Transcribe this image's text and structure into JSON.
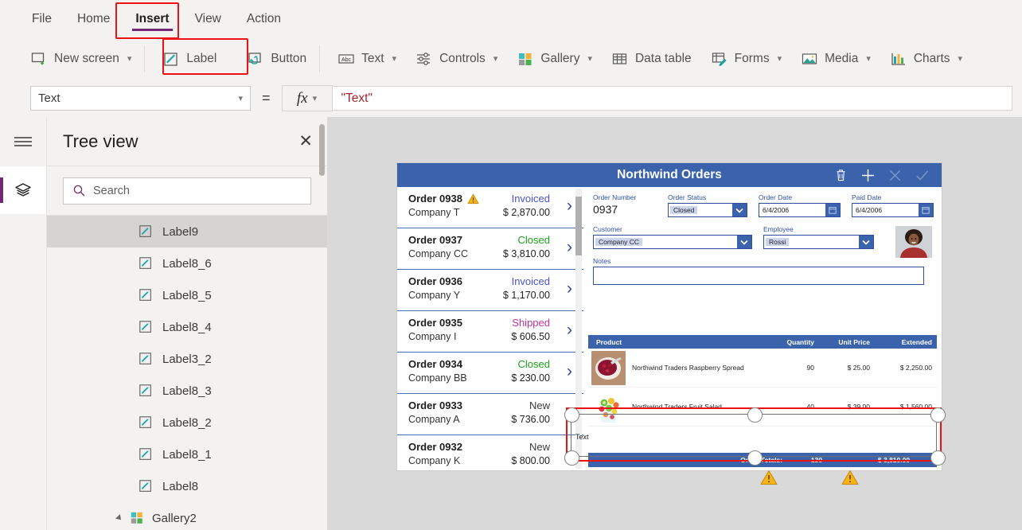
{
  "menubar": {
    "items": [
      {
        "label": "File",
        "active": false
      },
      {
        "label": "Home",
        "active": false
      },
      {
        "label": "Insert",
        "active": true
      },
      {
        "label": "View",
        "active": false
      },
      {
        "label": "Action",
        "active": false
      }
    ],
    "active_accent": "#742774"
  },
  "ribbon": {
    "items": [
      {
        "label": "New screen",
        "icon": "new-screen-icon",
        "has_chevron": true
      },
      {
        "label": "Label",
        "icon": "label-icon",
        "has_chevron": false,
        "highlighted": true
      },
      {
        "label": "Button",
        "icon": "button-icon",
        "has_chevron": false
      },
      {
        "label": "Text",
        "icon": "text-abc-icon",
        "has_chevron": true
      },
      {
        "label": "Controls",
        "icon": "controls-sliders-icon",
        "has_chevron": true
      },
      {
        "label": "Gallery",
        "icon": "gallery-squares-icon",
        "has_chevron": true
      },
      {
        "label": "Data table",
        "icon": "data-table-icon",
        "has_chevron": false
      },
      {
        "label": "Forms",
        "icon": "forms-icon",
        "has_chevron": true
      },
      {
        "label": "Media",
        "icon": "media-image-icon",
        "has_chevron": true
      },
      {
        "label": "Charts",
        "icon": "charts-bar-icon",
        "has_chevron": true
      }
    ]
  },
  "formula_bar": {
    "property": "Text",
    "equals": "=",
    "fx_label": "fx",
    "value": "\"Text\""
  },
  "treeview": {
    "title": "Tree view",
    "close_label": "✕",
    "search_placeholder": "Search",
    "items": [
      {
        "label": "Label9",
        "icon": "label-icon",
        "selected": true,
        "group": false
      },
      {
        "label": "Label8_6",
        "icon": "label-icon",
        "selected": false,
        "group": false
      },
      {
        "label": "Label8_5",
        "icon": "label-icon",
        "selected": false,
        "group": false
      },
      {
        "label": "Label8_4",
        "icon": "label-icon",
        "selected": false,
        "group": false
      },
      {
        "label": "Label3_2",
        "icon": "label-icon",
        "selected": false,
        "group": false
      },
      {
        "label": "Label8_3",
        "icon": "label-icon",
        "selected": false,
        "group": false
      },
      {
        "label": "Label8_2",
        "icon": "label-icon",
        "selected": false,
        "group": false
      },
      {
        "label": "Label8_1",
        "icon": "label-icon",
        "selected": false,
        "group": false
      },
      {
        "label": "Label8",
        "icon": "label-icon",
        "selected": false,
        "group": false
      },
      {
        "label": "Gallery2",
        "icon": "gallery-squares-icon",
        "selected": false,
        "group": true
      }
    ]
  },
  "app": {
    "title": "Northwind Orders",
    "header_icons": [
      {
        "name": "trash-icon",
        "dimmed": false
      },
      {
        "name": "plus-icon",
        "dimmed": false
      },
      {
        "name": "cancel-x-icon",
        "dimmed": true
      },
      {
        "name": "check-icon",
        "dimmed": true
      }
    ],
    "header_color": "#3a63ab",
    "orders": [
      {
        "number": "Order 0938",
        "company": "Company T",
        "status": "Invoiced",
        "status_color": "#4a52c9",
        "amount": "$ 2,870.00",
        "warning": true
      },
      {
        "number": "Order 0937",
        "company": "Company CC",
        "status": "Closed",
        "status_color": "#1aa01a",
        "amount": "$ 3,810.00",
        "warning": false
      },
      {
        "number": "Order 0936",
        "company": "Company Y",
        "status": "Invoiced",
        "status_color": "#4a52c9",
        "amount": "$ 1,170.00",
        "warning": false
      },
      {
        "number": "Order 0935",
        "company": "Company I",
        "status": "Shipped",
        "status_color": "#c3339b",
        "amount": "$ 606.50",
        "warning": false
      },
      {
        "number": "Order 0934",
        "company": "Company BB",
        "status": "Closed",
        "status_color": "#1aa01a",
        "amount": "$ 230.00",
        "warning": false
      },
      {
        "number": "Order 0933",
        "company": "Company A",
        "status": "New",
        "status_color": "#3b3a39",
        "amount": "$ 736.00",
        "warning": false
      },
      {
        "number": "Order 0932",
        "company": "Company K",
        "status": "New",
        "status_color": "#3b3a39",
        "amount": "$ 800.00",
        "warning": false
      }
    ],
    "detail": {
      "order_number_label": "Order Number",
      "order_number_value": "0937",
      "order_status_label": "Order Status",
      "order_status_value": "Closed",
      "order_date_label": "Order Date",
      "order_date_value": "6/4/2006",
      "paid_date_label": "Paid Date",
      "paid_date_value": "6/4/2006",
      "customer_label": "Customer",
      "customer_value": "Company CC",
      "employee_label": "Employee",
      "employee_value": "Rossi",
      "notes_label": "Notes",
      "notes_value": ""
    },
    "products_table": {
      "columns": [
        "Product",
        "Quantity",
        "Unit Price",
        "Extended"
      ],
      "rows": [
        {
          "product": "Northwind Traders Raspberry Spread",
          "quantity": "90",
          "unit_price": "$ 25.00",
          "extended": "$ 2,250.00",
          "thumb": "raspberry-spread-thumb"
        },
        {
          "product": "Northwind Traders Fruit Salad",
          "quantity": "40",
          "unit_price": "$ 39.00",
          "extended": "$ 1,560.00",
          "thumb": "fruit-salad-thumb"
        }
      ],
      "totals_label": "Order Totals:",
      "totals_quantity": "130",
      "totals_extended": "$ 3,810.00"
    },
    "selection": {
      "label_text": "Text",
      "outline_color": "#ee1111",
      "warning_count": 2
    }
  }
}
